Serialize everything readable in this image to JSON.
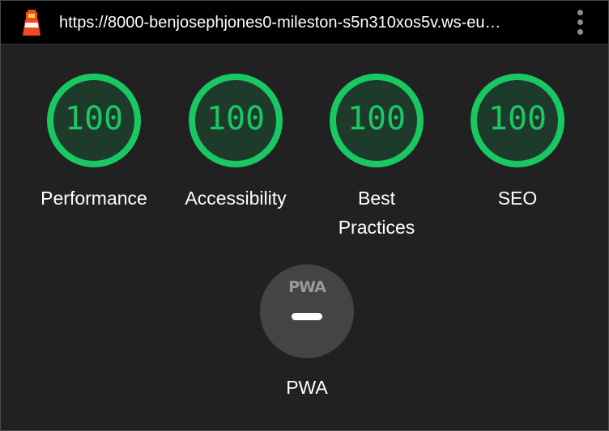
{
  "header": {
    "url": "https://8000-benjosephjones0-mileston-s5n310xos5v.ws-eu…",
    "logo_icon": "lighthouse-icon",
    "menu_icon": "kebab-menu-icon"
  },
  "categories": [
    {
      "id": "performance",
      "score": "100",
      "label_lines": [
        "Performance"
      ]
    },
    {
      "id": "accessibility",
      "score": "100",
      "label_lines": [
        "Accessibility"
      ]
    },
    {
      "id": "best-practices",
      "score": "100",
      "label_lines": [
        "Best",
        "Practices"
      ]
    },
    {
      "id": "seo",
      "score": "100",
      "label_lines": [
        "SEO"
      ]
    }
  ],
  "pwa": {
    "badge_text": "PWA",
    "label": "PWA",
    "status_icon": "dash-icon"
  },
  "colors": {
    "pass": "#19c863",
    "gauge_fill": "#1d3a2a",
    "background": "#212121",
    "topbar": "#000000",
    "pwa_circle": "#444444"
  }
}
